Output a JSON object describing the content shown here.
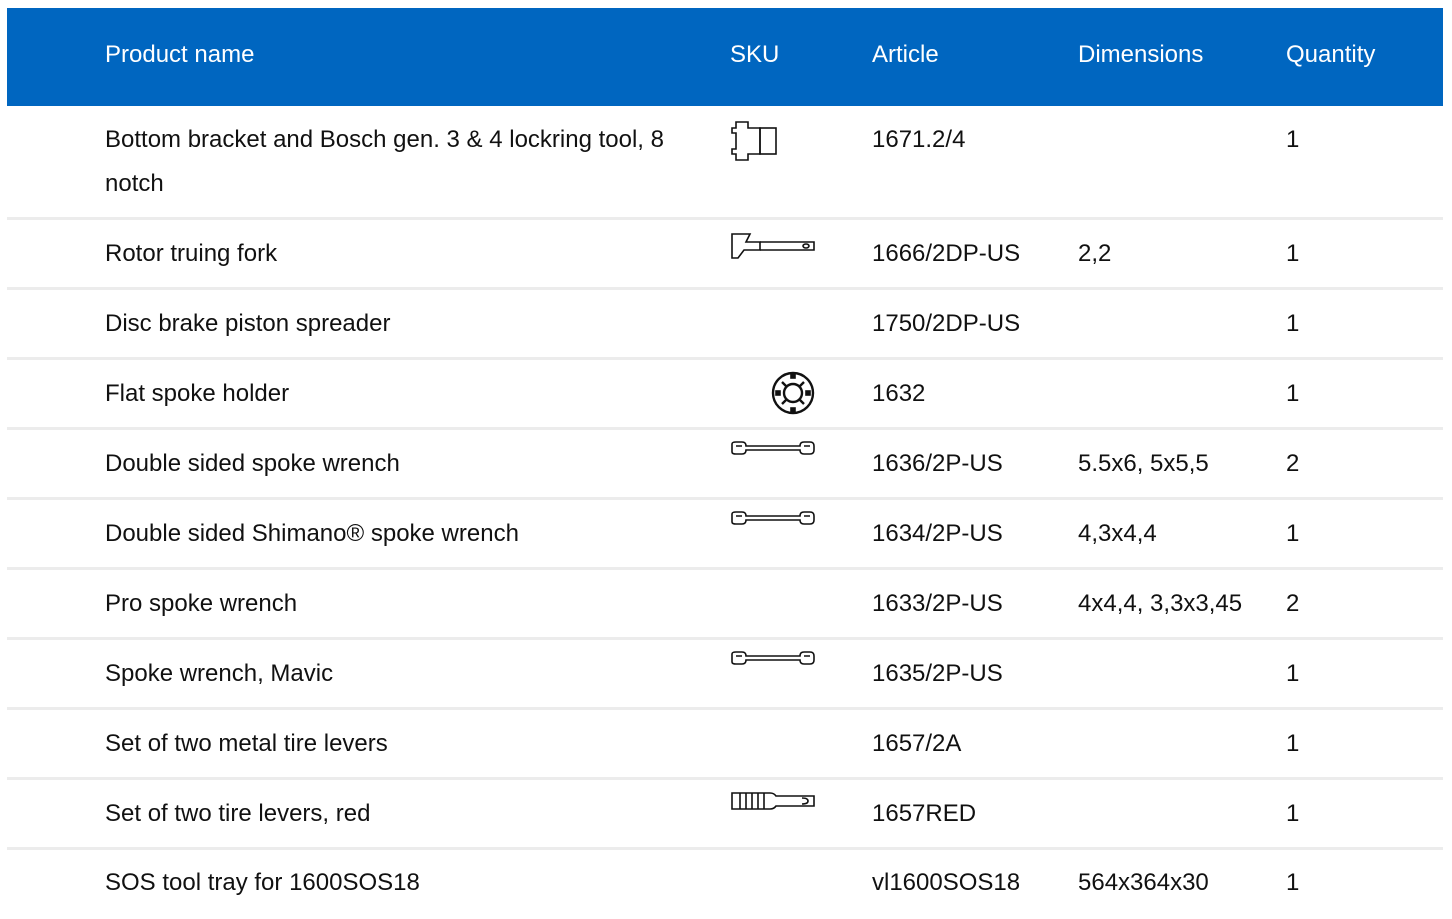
{
  "table": {
    "headers": {
      "product_name": "Product name",
      "sku": "SKU",
      "article": "Article",
      "dimensions": "Dimensions",
      "quantity": "Quantity"
    },
    "rows": [
      {
        "name": "Bottom bracket and Bosch gen. 3 & 4 lockring tool, 8 notch",
        "sku_icon": "lockring-tool-icon",
        "article": "1671.2/4",
        "dimensions": "",
        "quantity": "1"
      },
      {
        "name": "Rotor truing fork",
        "sku_icon": "rotor-fork-icon",
        "article": "1666/2DP-US",
        "dimensions": "2,2",
        "quantity": "1"
      },
      {
        "name": "Disc brake piston spreader",
        "sku_icon": "",
        "article": "1750/2DP-US",
        "dimensions": "",
        "quantity": "1"
      },
      {
        "name": "Flat spoke holder",
        "sku_icon": "spoke-holder-icon",
        "article": "1632",
        "dimensions": "",
        "quantity": "1"
      },
      {
        "name": "Double sided spoke wrench",
        "sku_icon": "spoke-wrench-icon",
        "article": "1636/2P-US",
        "dimensions": "5.5x6, 5x5,5",
        "quantity": "2"
      },
      {
        "name": "Double sided Shimano® spoke wrench",
        "sku_icon": "spoke-wrench-icon",
        "article": "1634/2P-US",
        "dimensions": "4,3x4,4",
        "quantity": "1"
      },
      {
        "name": "Pro spoke wrench",
        "sku_icon": "",
        "article": "1633/2P-US",
        "dimensions": "4x4,4, 3,3x3,45",
        "quantity": "2"
      },
      {
        "name": "Spoke wrench, Mavic",
        "sku_icon": "spoke-wrench-icon",
        "article": "1635/2P-US",
        "dimensions": "",
        "quantity": "1"
      },
      {
        "name": "Set of two metal tire levers",
        "sku_icon": "",
        "article": "1657/2A",
        "dimensions": "",
        "quantity": "1"
      },
      {
        "name": "Set of two tire levers, red",
        "sku_icon": "tire-lever-icon",
        "article": "1657RED",
        "dimensions": "",
        "quantity": "1"
      },
      {
        "name": "SOS tool tray for 1600SOS18",
        "sku_icon": "",
        "article": "vl1600SOS18",
        "dimensions": "564x364x30",
        "quantity": "1"
      }
    ]
  },
  "colors": {
    "header_bg": "#0066c0",
    "header_text": "#ffffff",
    "row_divider": "#ececec"
  }
}
